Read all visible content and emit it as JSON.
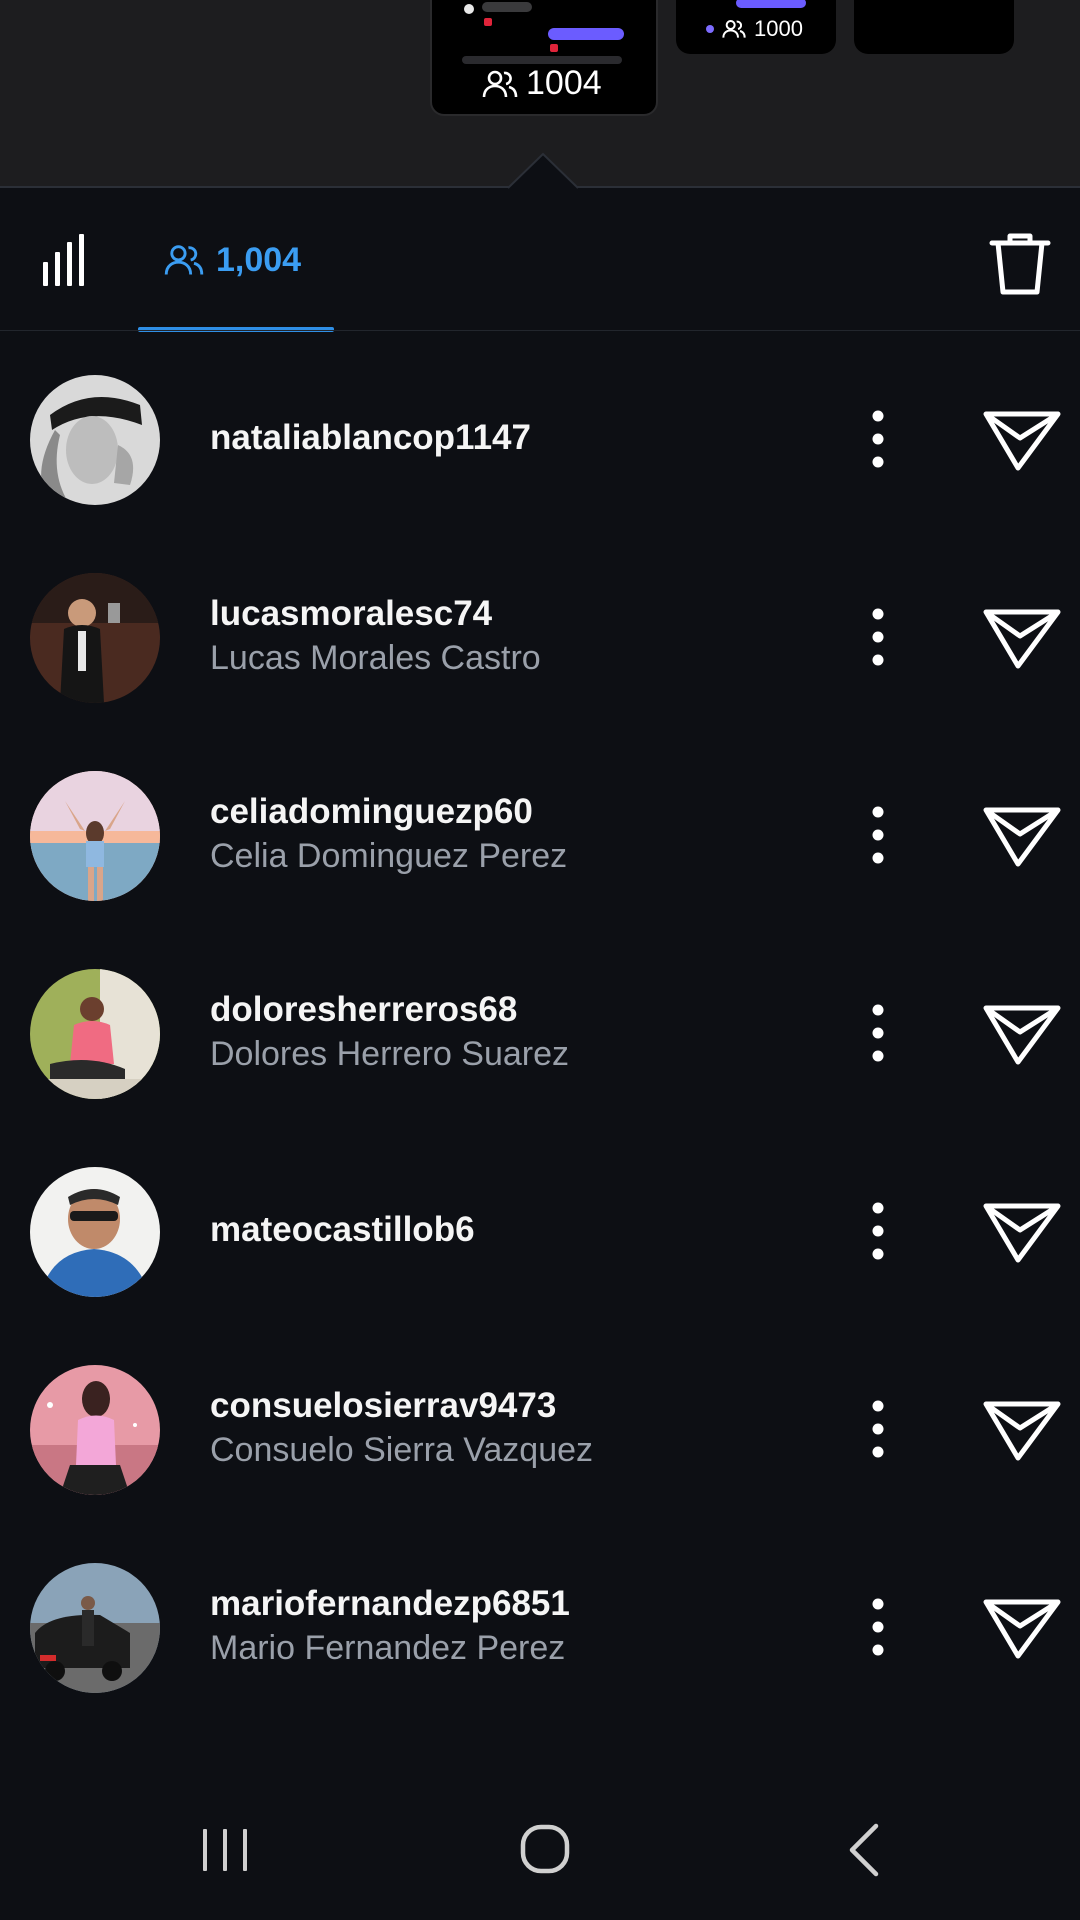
{
  "story_strip": {
    "current_story_count": "1004",
    "other_story_count": "1000"
  },
  "tabs": {
    "viewers_count": "1,004"
  },
  "viewers": [
    {
      "username": "nataliablancop1147",
      "full_name": ""
    },
    {
      "username": "lucasmoralesc74",
      "full_name": "Lucas Morales Castro"
    },
    {
      "username": "celiadominguezp60",
      "full_name": "Celia Dominguez Perez"
    },
    {
      "username": "doloresherreros68",
      "full_name": "Dolores Herrero Suarez"
    },
    {
      "username": "mateocastillob6",
      "full_name": ""
    },
    {
      "username": "consuelosierrav9473",
      "full_name": "Consuelo Sierra Vazquez"
    },
    {
      "username": "mariofernandezp6851",
      "full_name": "Mario Fernandez Perez"
    }
  ],
  "icons": {
    "insights": "bar-chart-icon",
    "viewers": "people-icon",
    "delete": "trash-icon",
    "more": "vertical-dots-icon",
    "send": "paper-plane-icon",
    "nav_recent": "recent-apps-icon",
    "nav_home": "home-icon",
    "nav_back": "back-icon"
  },
  "colors": {
    "background": "#0d0f14",
    "accent": "#3b9df2",
    "secondary_text": "#9aa0aa"
  }
}
